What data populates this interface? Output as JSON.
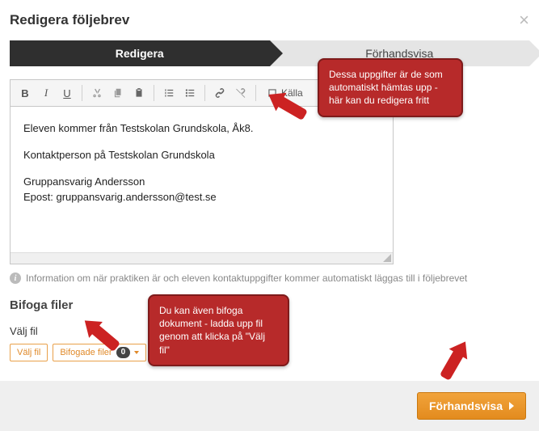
{
  "modal": {
    "title": "Redigera följebrev",
    "close_label": "×"
  },
  "wizard": {
    "active": "Redigera",
    "inactive": "Förhandsvisa"
  },
  "toolbar": {
    "bold": "B",
    "italic": "I",
    "underline": "U",
    "source_label": "Källa"
  },
  "editor": {
    "line1": "Eleven kommer från Testskolan Grundskola, Åk8.",
    "line2": "Kontaktperson på Testskolan Grundskola",
    "line3": "Gruppansvarig Andersson",
    "line4": "Epost: gruppansvarig.andersson@test.se"
  },
  "info": "Information om när praktiken är och eleven kontaktuppgifter kommer automatiskt läggas till i följebrevet",
  "attach": {
    "title": "Bifoga filer",
    "label": "Välj fil",
    "choose_btn": "Välj fil",
    "attached_btn": "Bifogade filer",
    "count": "0"
  },
  "footer": {
    "preview_btn": "Förhandsvisa"
  },
  "callouts": {
    "top": "Dessa uppgifter är de som automatiskt hämtas upp - här kan du redigera fritt",
    "mid": "Du kan även bifoga dokument - ladda upp fil genom att klicka på \"Välj fil\""
  }
}
